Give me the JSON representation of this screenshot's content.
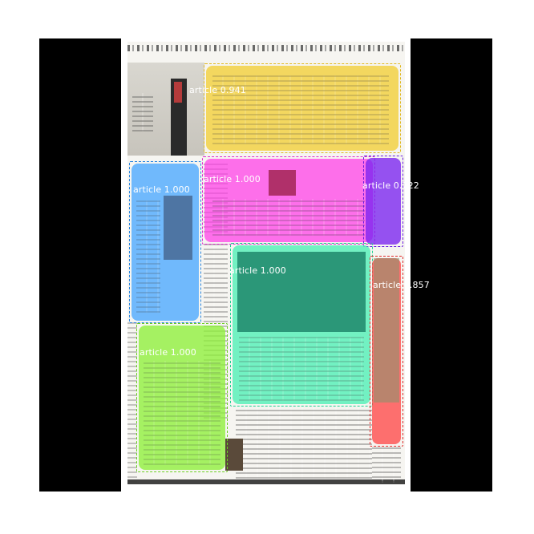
{
  "detections": [
    {
      "id": "d1",
      "label": "article",
      "score": "0.941",
      "color": "#f2cc2e"
    },
    {
      "id": "d2",
      "label": "article",
      "score": "1.000",
      "color": "#ff3ce8"
    },
    {
      "id": "d3",
      "label": "article",
      "score": "0.722",
      "color": "#7a22f0"
    },
    {
      "id": "d4",
      "label": "article",
      "score": "1.000",
      "color": "#4aa8ff"
    },
    {
      "id": "d5",
      "label": "article",
      "score": "1.000",
      "color": "#3ef0b0"
    },
    {
      "id": "d6",
      "label": "article",
      "score": "0.857",
      "color": "#ff3c3c"
    },
    {
      "id": "d7",
      "label": "article",
      "score": "1.000",
      "color": "#8ef03a"
    }
  ],
  "text": {
    "d1": "article 0.941",
    "d2": "article 1.000",
    "d3": "article 0.722",
    "d4": "article 1.000",
    "d5": "article 1.000",
    "d6": "article 0.857",
    "d7": "article 1.000"
  }
}
